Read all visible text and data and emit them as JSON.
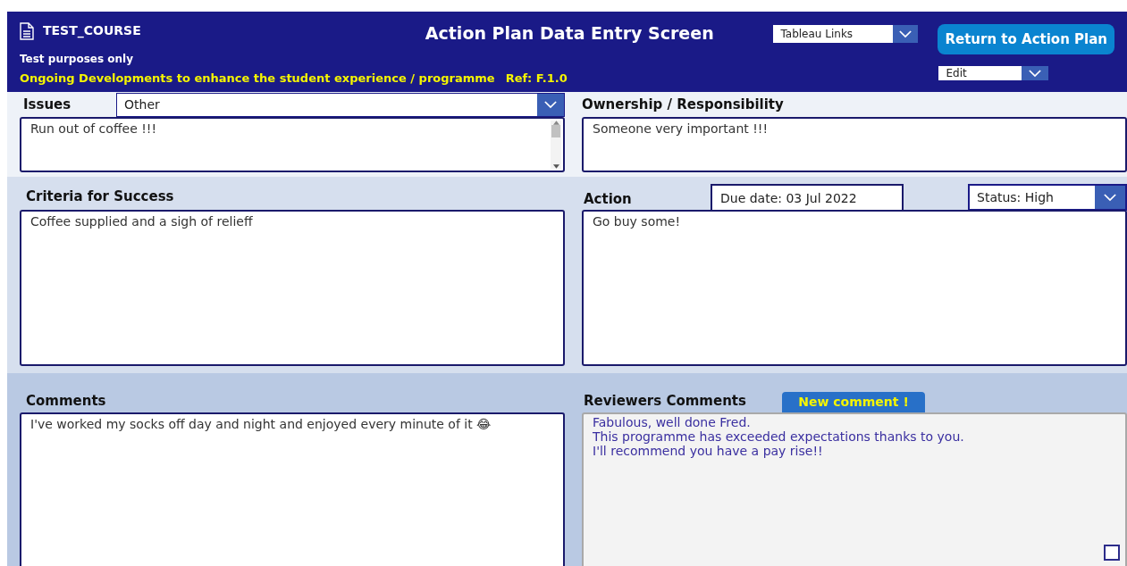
{
  "header": {
    "course": "TEST_COURSE",
    "title": "Action Plan Data Entry Screen",
    "subtitle": "Test purposes only",
    "description": "Ongoing Developments to enhance the student experience / programme",
    "ref": "Ref: F.1.0",
    "links_dropdown": "Tableau Links",
    "return_button": "Return to Action Plan",
    "mode_dropdown": "Edit"
  },
  "issues": {
    "label": "Issues",
    "dropdown": "Other",
    "text": "Run out of coffee !!!"
  },
  "ownership": {
    "label": "Ownership / Responsibility",
    "text": "Someone very important !!!"
  },
  "criteria": {
    "label": "Criteria for Success",
    "text": "Coffee supplied and a sigh of relieff"
  },
  "action": {
    "label": "Action",
    "due_date": "Due date: 03 Jul 2022",
    "status": "Status: High",
    "text": "Go buy some!"
  },
  "comments": {
    "label": "Comments",
    "text": "I've worked my socks off day and night and enjoyed every minute of it 😂"
  },
  "reviewers": {
    "label": "Reviewers Comments",
    "badge": "New comment !",
    "lines": [
      "Fabulous, well done Fred.",
      "This programme has exceeded expectations thanks to you.",
      "I'll recommend you have a pay rise!!"
    ],
    "checked": false
  }
}
